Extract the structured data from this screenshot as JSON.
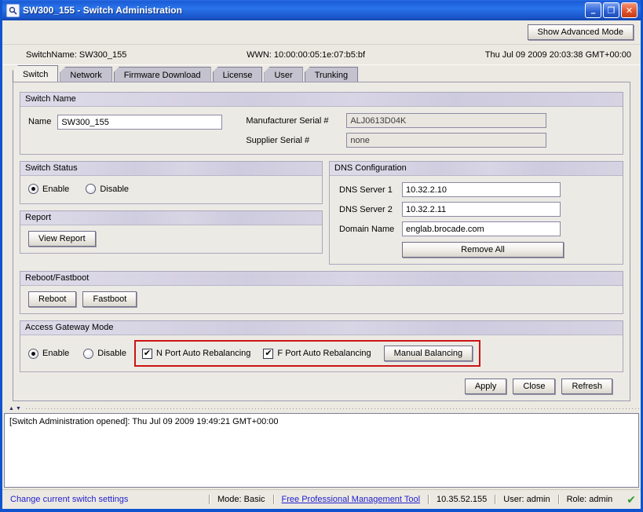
{
  "window": {
    "title": "SW300_155 - Switch Administration",
    "controls": {
      "minimize": "–",
      "maximize": "❐",
      "close": "✕"
    }
  },
  "toolbar": {
    "show_advanced_mode": "Show Advanced Mode"
  },
  "info_bar": {
    "switch_name": "SwitchName: SW300_155",
    "wwn": "WWN: 10:00:00:05:1e:07:b5:bf",
    "datetime": "Thu Jul 09 2009 20:03:38 GMT+00:00"
  },
  "tabs": [
    {
      "label": "Switch",
      "active": true
    },
    {
      "label": "Network",
      "active": false
    },
    {
      "label": "Firmware Download",
      "active": false
    },
    {
      "label": "License",
      "active": false
    },
    {
      "label": "User",
      "active": false
    },
    {
      "label": "Trunking",
      "active": false
    }
  ],
  "sections": {
    "switch_name": {
      "title": "Switch Name",
      "name_label": "Name",
      "name_value": "SW300_155",
      "manufacturer_label": "Manufacturer Serial #",
      "manufacturer_value": "ALJ0613D04K",
      "supplier_label": "Supplier Serial #",
      "supplier_value": "none"
    },
    "switch_status": {
      "title": "Switch Status",
      "enable_label": "Enable",
      "disable_label": "Disable",
      "selected": "Enable"
    },
    "report": {
      "title": "Report",
      "view_report_label": "View Report"
    },
    "dns": {
      "title": "DNS Configuration",
      "server1_label": "DNS Server 1",
      "server1_value": "10.32.2.10",
      "server2_label": "DNS Server 2",
      "server2_value": "10.32.2.11",
      "domain_label": "Domain Name",
      "domain_value": "englab.brocade.com",
      "remove_all_label": "Remove All"
    },
    "reboot": {
      "title": "Reboot/Fastboot",
      "reboot_label": "Reboot",
      "fastboot_label": "Fastboot"
    },
    "access_gateway": {
      "title": "Access Gateway Mode",
      "enable_label": "Enable",
      "disable_label": "Disable",
      "selected": "Enable",
      "nport_label": "N Port Auto Rebalancing",
      "nport_checked": true,
      "fport_label": "F Port Auto Rebalancing",
      "fport_checked": true,
      "manual_balancing_label": "Manual Balancing",
      "highlight_color": "#cc1414"
    }
  },
  "actions": {
    "apply": "Apply",
    "close": "Close",
    "refresh": "Refresh"
  },
  "log": {
    "entry": "[Switch Administration opened]: Thu Jul 09 2009 19:49:21 GMT+00:00"
  },
  "status_bar": {
    "left": "Change current switch settings",
    "mode": "Mode: Basic",
    "link": "Free Professional Management Tool",
    "ip": "10.35.52.155",
    "user": "User: admin",
    "role": "Role: admin"
  },
  "icons": {
    "checkbox_check": "✔",
    "status_ok": "✔",
    "splitter_up": "▲",
    "splitter_down": "▼"
  }
}
